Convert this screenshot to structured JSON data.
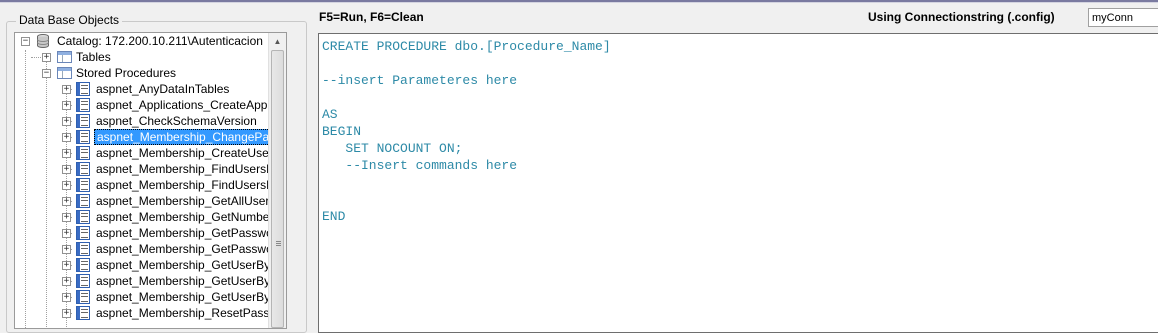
{
  "window": {
    "accent": "#3399ff"
  },
  "left_panel": {
    "title": "Data Base Objects",
    "tree": {
      "catalog": "Catalog: 172.200.10.211\\Autenticacion",
      "tables": "Tables",
      "stored_procedures": "Stored Procedures",
      "procedures": [
        "aspnet_AnyDataInTables",
        "aspnet_Applications_CreateAppli",
        "aspnet_CheckSchemaVersion",
        "aspnet_Membership_ChangePass",
        "aspnet_Membership_CreateUser",
        "aspnet_Membership_FindUsersBy",
        "aspnet_Membership_FindUsersBy",
        "aspnet_Membership_GetAllUsers",
        "aspnet_Membership_GetNumberO",
        "aspnet_Membership_GetPasswor",
        "aspnet_Membership_GetPasswor",
        "aspnet_Membership_GetUserByE",
        "aspnet_Membership_GetUserByN",
        "aspnet_Membership_GetUserByU",
        "aspnet_Membership_ResetPassw"
      ],
      "selected_index": 3
    },
    "scroll_up_glyph": "▲"
  },
  "toolbar": {
    "hint": "F5=Run, F6=Clean",
    "connection_label": "Using Connectionstring (.config)",
    "connection_value": "myConn"
  },
  "editor": {
    "lines": [
      "CREATE PROCEDURE dbo.[Procedure_Name]",
      "",
      "--insert Parameteres here",
      "",
      "AS",
      "BEGIN",
      "   SET NOCOUNT ON;",
      "   --Insert commands here",
      "",
      "",
      "END"
    ],
    "text_color": "#2d8aa7"
  }
}
